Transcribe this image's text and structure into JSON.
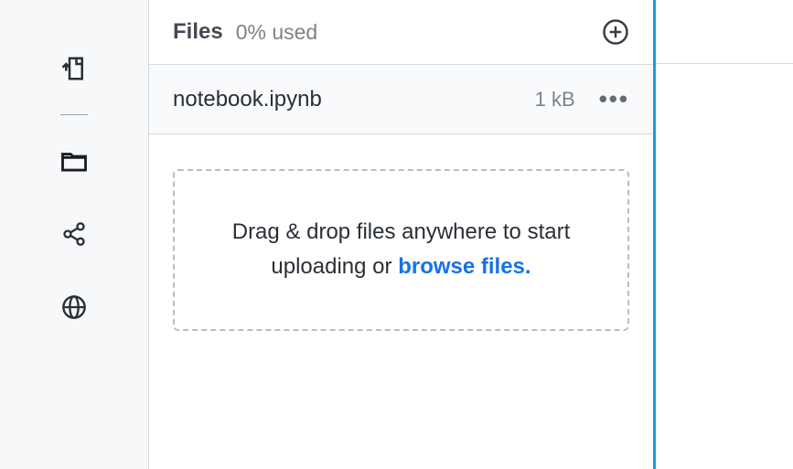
{
  "sidebar": {
    "upload_icon": "upload-file",
    "folder_icon": "folder",
    "share_icon": "share-nodes",
    "web_icon": "globe"
  },
  "panel": {
    "title": "Files",
    "usage": "0% used",
    "add_label": "Add file"
  },
  "files": [
    {
      "name": "notebook.ipynb",
      "size": "1 kB"
    }
  ],
  "dropzone": {
    "text_pre": "Drag & drop files anywhere to start uploading or ",
    "browse": "browse files."
  }
}
